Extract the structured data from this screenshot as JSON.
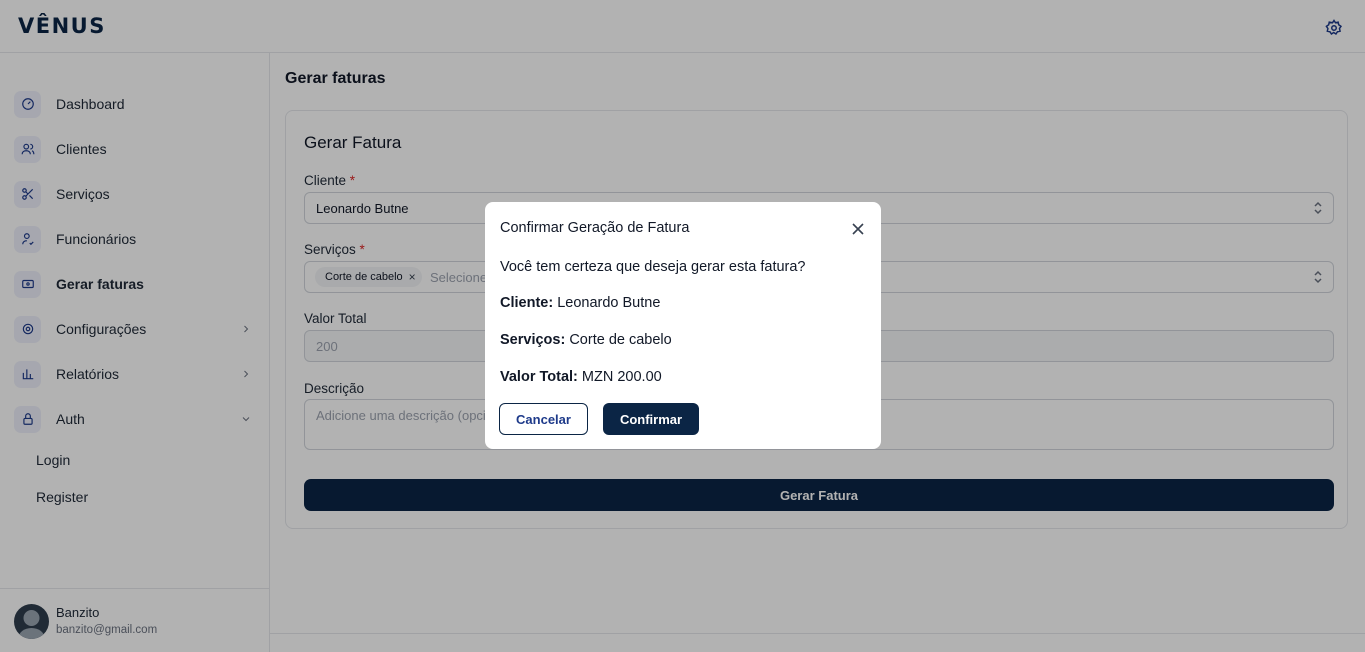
{
  "app": {
    "logo": "VÊNUS"
  },
  "sidebar": {
    "items": [
      {
        "label": "Dashboard",
        "icon": "dashboard-icon"
      },
      {
        "label": "Clientes",
        "icon": "users-icon"
      },
      {
        "label": "Serviços",
        "icon": "scissors-icon"
      },
      {
        "label": "Funcionários",
        "icon": "user-check-icon"
      },
      {
        "label": "Gerar faturas",
        "icon": "invoice-icon",
        "active": true
      },
      {
        "label": "Configurações",
        "icon": "gear-icon",
        "has_submenu": true
      },
      {
        "label": "Relatórios",
        "icon": "chart-icon",
        "has_submenu": true
      },
      {
        "label": "Auth",
        "icon": "lock-icon",
        "expanded": true
      }
    ],
    "auth_sub": [
      {
        "label": "Login"
      },
      {
        "label": "Register"
      }
    ],
    "user": {
      "name": "Banzito",
      "email": "banzito@gmail.com"
    }
  },
  "main": {
    "page_title": "Gerar faturas",
    "form": {
      "title": "Gerar Fatura",
      "cliente_label": "Cliente",
      "cliente_value": "Leonardo Butne",
      "servicos_label": "Serviços",
      "servicos_tag": "Corte de cabelo",
      "servicos_placeholder": "Selecione",
      "valor_label": "Valor Total",
      "valor_value": "200",
      "descricao_label": "Descrição",
      "descricao_placeholder": "Adicione uma descrição (opcio",
      "submit_label": "Gerar Fatura",
      "required_mark": "*",
      "tag_remove": "×"
    }
  },
  "modal": {
    "title": "Confirmar Geração de Fatura",
    "question": "Você tem certeza que deseja gerar esta fatura?",
    "cliente_label": "Cliente:",
    "cliente_value": "Leonardo Butne",
    "servicos_label": "Serviços:",
    "servicos_value": "Corte de cabelo",
    "valor_label": "Valor Total:",
    "valor_value": "MZN 200.00",
    "cancel_label": "Cancelar",
    "confirm_label": "Confirmar"
  },
  "colors": {
    "primary": "#0b2545",
    "required": "#dc2626",
    "icon_bg": "#eef0fb"
  }
}
